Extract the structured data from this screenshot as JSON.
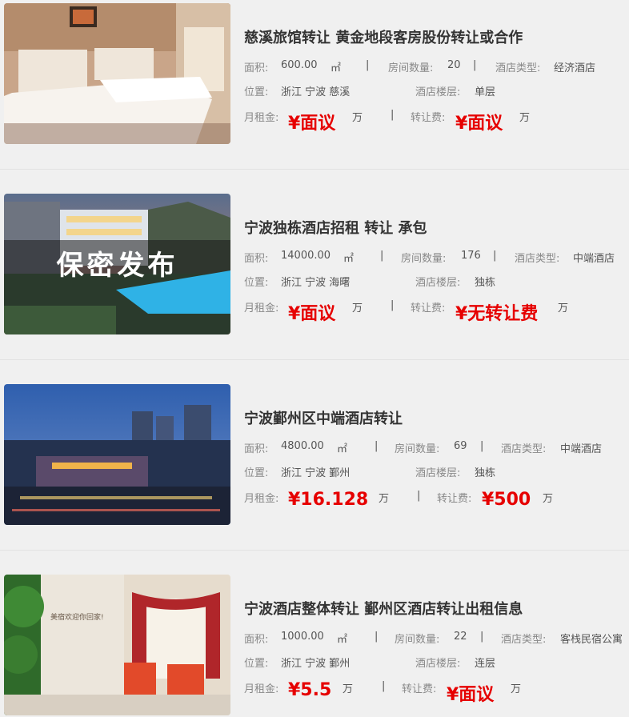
{
  "labels": {
    "area": "面积:",
    "rooms": "房间数量:",
    "hotel_type": "酒店类型:",
    "location": "位置:",
    "floor": "酒店楼层:",
    "rent": "月租金:",
    "transfer": "转让费:",
    "area_unit": "㎡",
    "wan": "万",
    "sep": "|"
  },
  "listings": [
    {
      "title": "慈溪旅馆转让 黄金地段客房股份转让或合作",
      "area": "600.00",
      "rooms": "20",
      "hotel_type": "经济酒店",
      "location": "浙江 宁波 慈溪",
      "floor": "单层",
      "rent": "¥面议",
      "transfer": "¥面议",
      "image_overlay": ""
    },
    {
      "title": "宁波独栋酒店招租 转让 承包",
      "area": "14000.00",
      "rooms": "176",
      "hotel_type": "中端酒店",
      "location": "浙江 宁波 海曙",
      "floor": "独栋",
      "rent": "¥面议",
      "transfer": "¥无转让费",
      "image_overlay": "保密发布"
    },
    {
      "title": "宁波鄞州区中端酒店转让",
      "area": "4800.00",
      "rooms": "69",
      "hotel_type": "中端酒店",
      "location": "浙江 宁波 鄞州",
      "floor": "独栋",
      "rent": "¥16.128",
      "transfer": "¥500",
      "image_overlay": ""
    },
    {
      "title": "宁波酒店整体转让 鄞州区酒店转让出租信息",
      "area": "1000.00",
      "rooms": "22",
      "hotel_type": "客栈民宿公寓",
      "location": "浙江 宁波 鄞州",
      "floor": "连层",
      "rent": "¥5.5",
      "transfer": "¥面议",
      "image_overlay": "",
      "image_wall_text": "美宿欢迎你回家!"
    }
  ]
}
